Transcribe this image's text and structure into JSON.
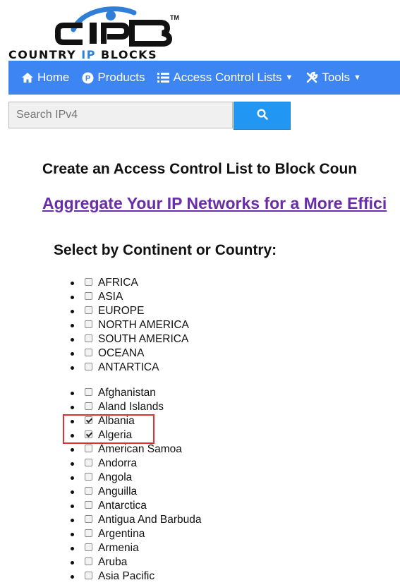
{
  "logo": {
    "wordmark": "CIPB",
    "tm": "TM",
    "tagline_part1": "COUNTRY",
    "tagline_ip": "IP",
    "tagline_part2": "BLOCKS"
  },
  "colors": {
    "navbar": "#3d85f2",
    "search_button": "#2196f3",
    "link": "#6a2da8",
    "highlight_border": "#e03030",
    "logo_arc": "#2f7fd8"
  },
  "nav": {
    "home": {
      "label": "Home",
      "icon": "home-icon"
    },
    "products": {
      "label": "Products",
      "icon": "products-circle-p-icon"
    },
    "acl": {
      "label": "Access Control Lists",
      "icon": "list-icon",
      "caret": "caret-down-icon"
    },
    "tools": {
      "label": "Tools",
      "icon": "wrench-icon",
      "caret": "caret-down-icon"
    }
  },
  "search": {
    "placeholder": "Search IPv4",
    "value": "",
    "button_icon": "search-icon"
  },
  "headings": {
    "create": "Create an Access Control List to Block Coun",
    "aggregate": "Aggregate Your IP Networks for a More Effici",
    "select": "Select by Continent or Country:"
  },
  "continents": [
    {
      "label": "AFRICA",
      "checked": false
    },
    {
      "label": "ASIA",
      "checked": false
    },
    {
      "label": "EUROPE",
      "checked": false
    },
    {
      "label": "NORTH AMERICA",
      "checked": false
    },
    {
      "label": "SOUTH AMERICA",
      "checked": false
    },
    {
      "label": "OCEANA",
      "checked": false
    },
    {
      "label": "ANTARTICA",
      "checked": false
    }
  ],
  "countries": [
    {
      "label": "Afghanistan",
      "checked": false
    },
    {
      "label": "Aland Islands",
      "checked": false
    },
    {
      "label": "Albania",
      "checked": true
    },
    {
      "label": "Algeria",
      "checked": true
    },
    {
      "label": "American Samoa",
      "checked": false
    },
    {
      "label": "Andorra",
      "checked": false
    },
    {
      "label": "Angola",
      "checked": false
    },
    {
      "label": "Anguilla",
      "checked": false
    },
    {
      "label": "Antarctica",
      "checked": false
    },
    {
      "label": "Antigua And Barbuda",
      "checked": false
    },
    {
      "label": "Argentina",
      "checked": false
    },
    {
      "label": "Armenia",
      "checked": false
    },
    {
      "label": "Aruba",
      "checked": false
    },
    {
      "label": "Asia Pacific",
      "checked": false
    }
  ]
}
